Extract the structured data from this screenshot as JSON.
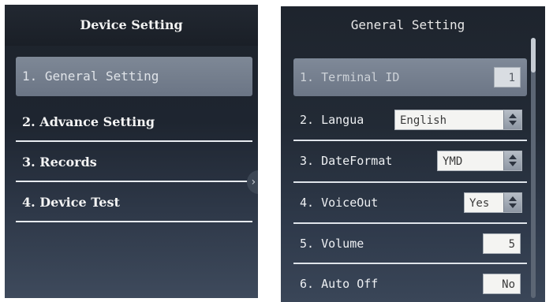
{
  "device_menu": {
    "title": "Device Setting",
    "items": [
      {
        "label": "1. General Setting",
        "selected": true
      },
      {
        "label": "2. Advance Setting",
        "selected": false
      },
      {
        "label": "3. Records",
        "selected": false
      },
      {
        "label": "4. Device Test",
        "selected": false
      }
    ],
    "arrow_icon": "chevron-right-icon"
  },
  "general_setting": {
    "title": "General Setting",
    "rows": [
      {
        "label": "1. Terminal ID",
        "value": "1"
      },
      {
        "label": "2. Langua",
        "value": "English"
      },
      {
        "label": "3. DateFormat",
        "value": "YMD"
      },
      {
        "label": "4. VoiceOut",
        "value": "Yes"
      },
      {
        "label": "5. Volume",
        "value": "5"
      },
      {
        "label": "6. Auto Off",
        "value": "No"
      }
    ]
  },
  "colors": {
    "background": "#1e242d",
    "highlight": "#7a8494",
    "text": "#f4f4f4",
    "field": "#f4f4f2"
  }
}
